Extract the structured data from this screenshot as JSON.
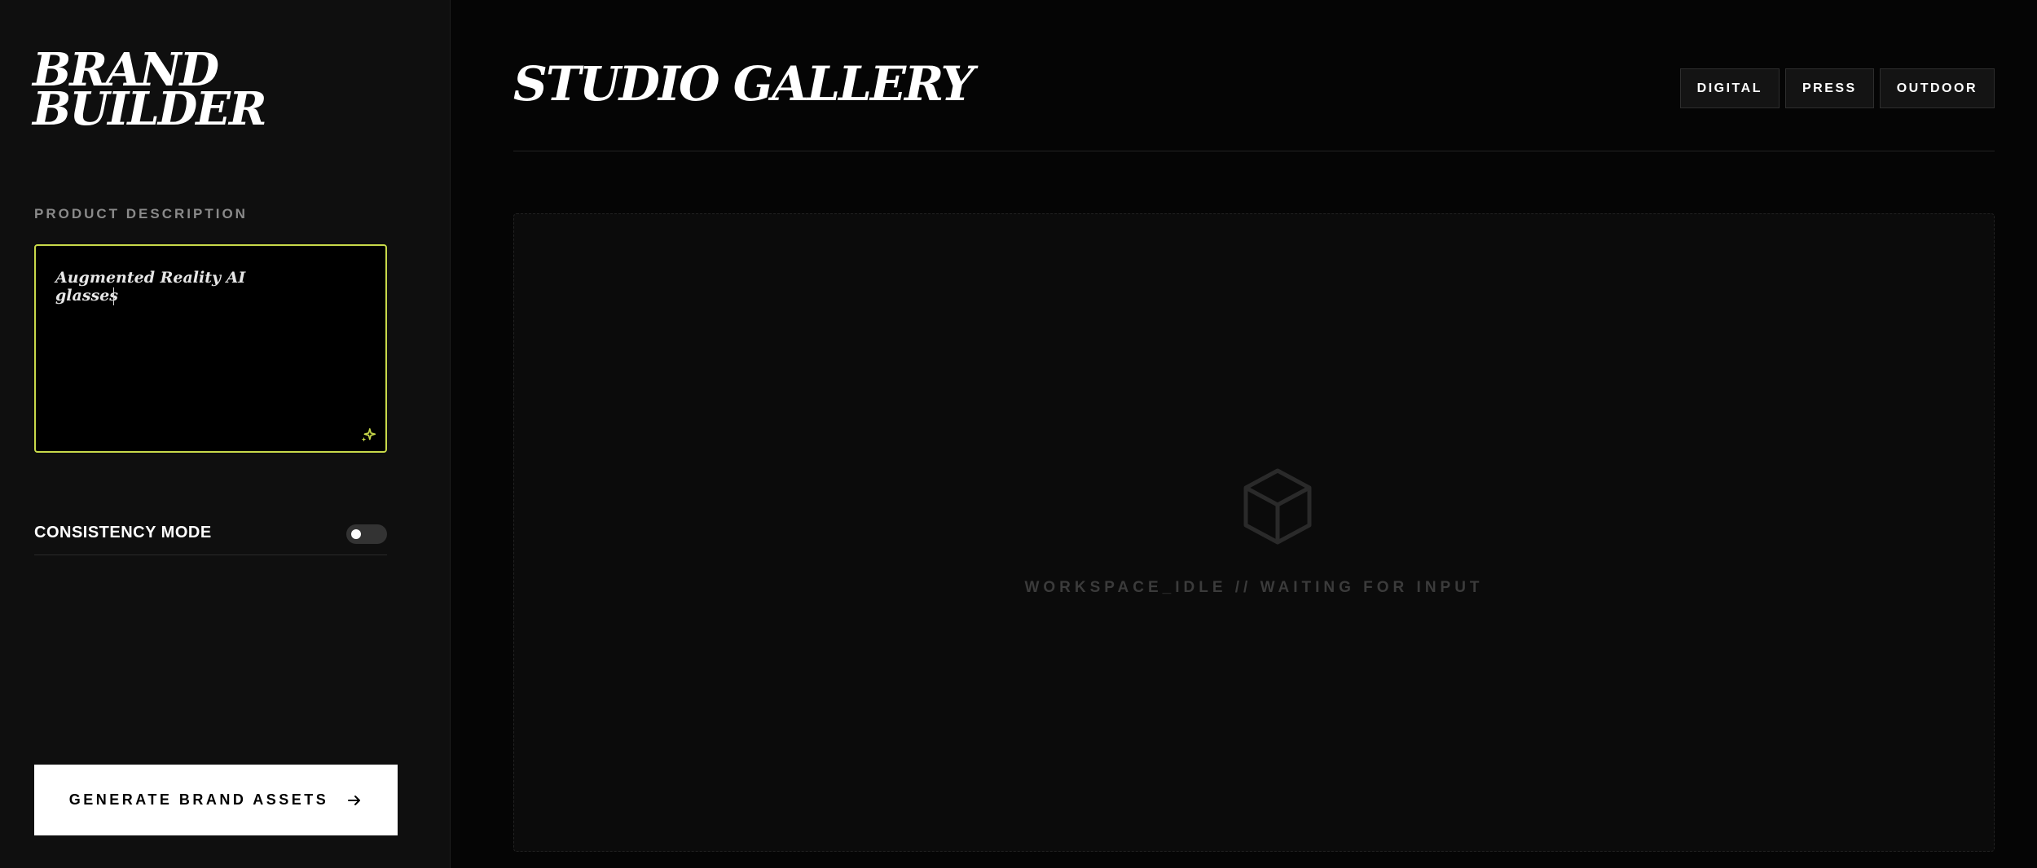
{
  "sidebar": {
    "brand_line1": "BRAND",
    "brand_line2": "BUILDER",
    "description_label": "PRODUCT DESCRIPTION",
    "description_value": "Augmented Reality AI glasses",
    "sparkle_icon": "sparkle-icon",
    "consistency_label": "CONSISTENCY MODE",
    "consistency_enabled": false,
    "generate_label": "GENERATE BRAND ASSETS",
    "arrow_icon": "arrow-right-icon"
  },
  "main": {
    "title": "STUDIO GALLERY",
    "filters": [
      {
        "label": "DIGITAL"
      },
      {
        "label": "PRESS"
      },
      {
        "label": "OUTDOOR"
      }
    ],
    "workspace": {
      "icon": "cube-icon",
      "status": "WORKSPACE_IDLE // WAITING FOR INPUT"
    }
  },
  "colors": {
    "accent": "#c8d94a",
    "sidebar_bg": "#0f0f0f",
    "main_bg": "#050505",
    "button_bg": "#ffffff"
  }
}
